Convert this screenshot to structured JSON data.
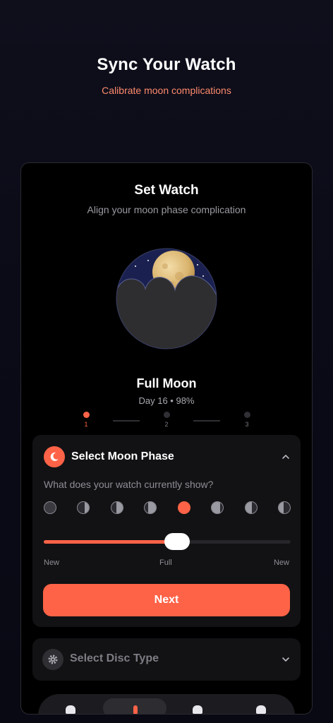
{
  "header": {
    "title": "Sync Your Watch",
    "subtitle": "Calibrate moon complications"
  },
  "card": {
    "title": "Set Watch",
    "subtitle": "Align your moon phase complication",
    "phase_name": "Full Moon",
    "phase_info": "Day 16 • 98%"
  },
  "steps": [
    {
      "label": "1",
      "active": true
    },
    {
      "label": "2",
      "active": false
    },
    {
      "label": "3",
      "active": false
    }
  ],
  "moon_panel": {
    "title": "Select Moon Phase",
    "question": "What does your watch currently show?",
    "phase_count": 8,
    "selected_phase_index": 4,
    "slider_value_fraction": 0.54,
    "scale_labels": {
      "left": "New",
      "center": "Full",
      "right": "New"
    },
    "next_label": "Next"
  },
  "disc_panel": {
    "title": "Select Disc Type"
  },
  "icons": {
    "moon_badge": "crescent-moon-icon",
    "gear_badge": "gear-icon",
    "expand": "chevron-up-icon",
    "collapse": "chevron-down-icon"
  },
  "colors": {
    "accent": "#ff6347",
    "subtitle": "#ff8a6b",
    "sky": "#1a2150",
    "moon": "#e8c98a",
    "cloud": "#2e2e30"
  }
}
